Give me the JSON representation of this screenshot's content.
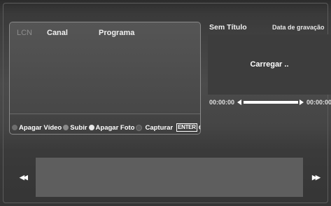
{
  "list": {
    "columns": {
      "lcn": "LCN",
      "canal": "Canal",
      "programa": "Programa"
    },
    "rows": []
  },
  "actions": [
    {
      "label": "Apagar Vídeo",
      "color": "#6e6e6e"
    },
    {
      "label": "Subir",
      "color": "#8a8a8a"
    },
    {
      "label": "Apagar Foto",
      "color": "#e8e8e8"
    },
    {
      "label": "Capturar",
      "color": "#5a5a5a"
    }
  ],
  "enter": {
    "key": "ENTER",
    "label": "OK"
  },
  "preview": {
    "title": "Sem Título",
    "date_label": "Data de gravação",
    "status": "Carregar ..",
    "time_start": "00:00:00",
    "time_end": "00:00:00",
    "progress": 0
  },
  "nav": {
    "prev_icon": "skip-back-icon",
    "next_icon": "skip-forward-icon"
  }
}
